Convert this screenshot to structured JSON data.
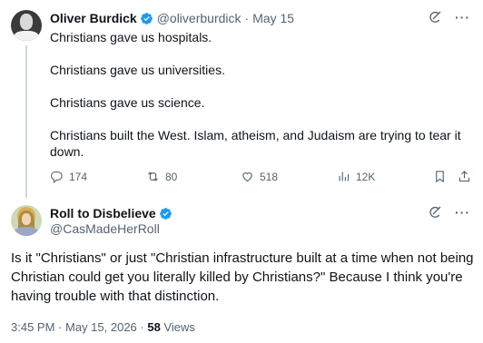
{
  "tweet1": {
    "author_name": "Oliver Burdick",
    "handle": "@oliverburdick",
    "separator": "·",
    "date": "May 15",
    "paragraphs": [
      "Christians gave us hospitals.",
      "Christians gave us universities.",
      "Christians gave us science.",
      "Christians built the West. Islam, atheism, and Judaism are trying to tear it down."
    ],
    "stats": {
      "replies": "174",
      "reposts": "80",
      "likes": "518",
      "views": "12K"
    },
    "more_label": "···"
  },
  "tweet2": {
    "author_name": "Roll to Disbelieve",
    "handle": "@CasMadeHerRoll",
    "text": "Is it \"Christians\" or just \"Christian infrastructure built at a time when not being Christian could get you literally killed by Christians?\" Because I think you're having trouble with that distinction.",
    "time": "3:45 PM",
    "separator": "·",
    "date": "May 15, 2026",
    "separator2": "·",
    "views_count": "58",
    "views_label": "Views",
    "more_label": "···"
  },
  "colors": {
    "text": "#0f1419",
    "secondary": "#536471",
    "verified": "#1d9bf0",
    "thread_line": "#cfd9de"
  },
  "icons": [
    "grok-icon",
    "more-icon",
    "reply-icon",
    "repost-icon",
    "like-icon",
    "views-icon",
    "bookmark-icon",
    "share-icon",
    "verified-badge-icon"
  ]
}
